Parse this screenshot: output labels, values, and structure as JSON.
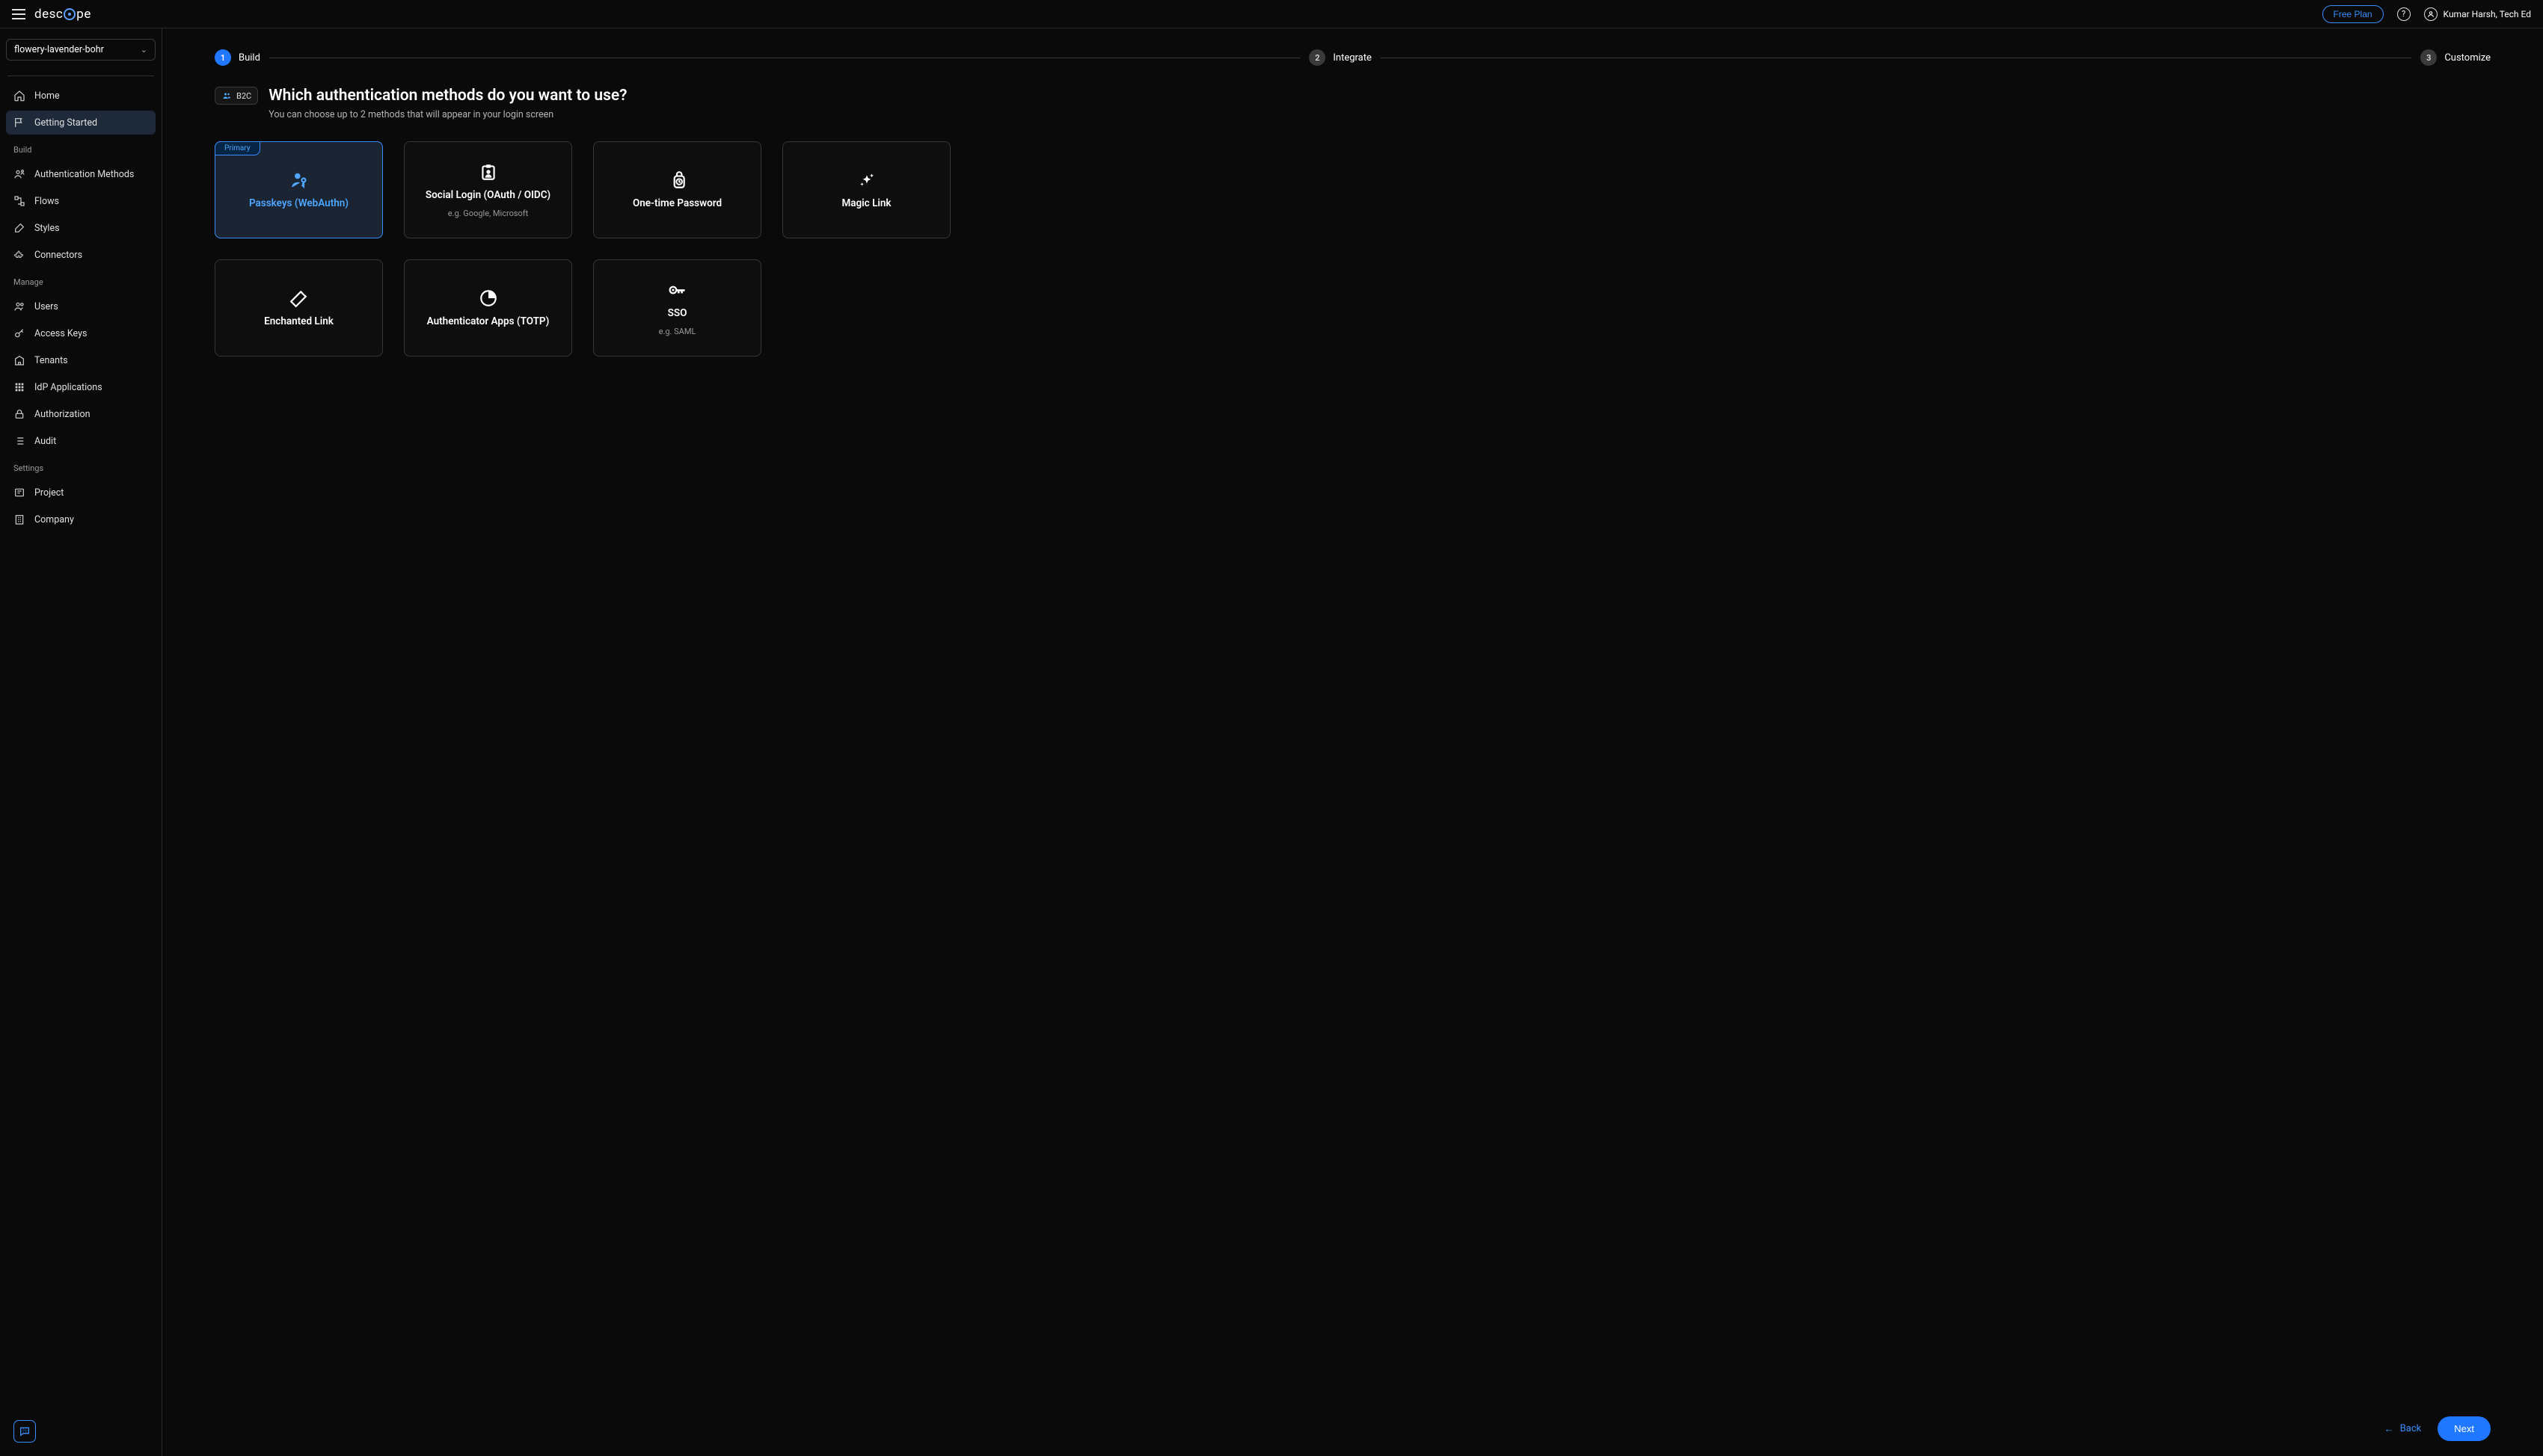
{
  "header": {
    "free_plan": "Free Plan",
    "user_name": "Kumar Harsh, Tech Ed"
  },
  "sidebar": {
    "project_name": "flowery-lavender-bohr",
    "items_top": [
      {
        "label": "Home",
        "icon": "home"
      },
      {
        "label": "Getting Started",
        "icon": "flag",
        "active": true
      }
    ],
    "section_build": "Build",
    "items_build": [
      {
        "label": "Authentication Methods",
        "icon": "shield-user"
      },
      {
        "label": "Flows",
        "icon": "flow"
      },
      {
        "label": "Styles",
        "icon": "brush"
      },
      {
        "label": "Connectors",
        "icon": "puzzle"
      }
    ],
    "section_manage": "Manage",
    "items_manage": [
      {
        "label": "Users",
        "icon": "users"
      },
      {
        "label": "Access Keys",
        "icon": "key"
      },
      {
        "label": "Tenants",
        "icon": "building"
      },
      {
        "label": "IdP Applications",
        "icon": "grid-apps"
      },
      {
        "label": "Authorization",
        "icon": "lock"
      },
      {
        "label": "Audit",
        "icon": "list"
      }
    ],
    "section_settings": "Settings",
    "items_settings": [
      {
        "label": "Project",
        "icon": "folder"
      },
      {
        "label": "Company",
        "icon": "office"
      }
    ]
  },
  "stepper": {
    "steps": [
      {
        "num": "1",
        "label": "Build",
        "active": true
      },
      {
        "num": "2",
        "label": "Integrate",
        "active": false
      },
      {
        "num": "3",
        "label": "Customize",
        "active": false
      }
    ]
  },
  "page": {
    "chip_label": "B2C",
    "title": "Which authentication methods do you want to use?",
    "subtitle": "You can choose up to 2 methods that will appear in your login screen",
    "primary_tag": "Primary",
    "cards": [
      {
        "title": "Passkeys (WebAuthn)",
        "sub": "",
        "selected": true
      },
      {
        "title": "Social Login (OAuth / OIDC)",
        "sub": "e.g. Google, Microsoft"
      },
      {
        "title": "One-time Password",
        "sub": ""
      },
      {
        "title": "Magic Link",
        "sub": ""
      },
      {
        "title": "Enchanted Link",
        "sub": ""
      },
      {
        "title": "Authenticator Apps (TOTP)",
        "sub": ""
      },
      {
        "title": "SSO",
        "sub": "e.g. SAML"
      }
    ]
  },
  "footer": {
    "back": "Back",
    "next": "Next"
  }
}
